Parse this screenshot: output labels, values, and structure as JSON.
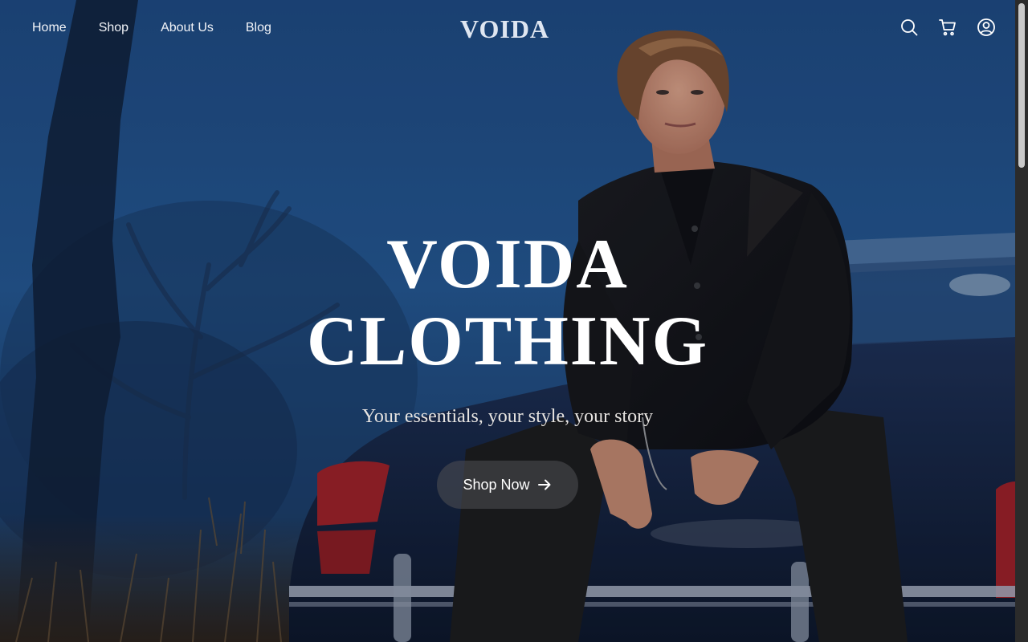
{
  "header": {
    "nav": [
      {
        "label": "Home"
      },
      {
        "label": "Shop"
      },
      {
        "label": "About Us"
      },
      {
        "label": "Blog"
      }
    ],
    "brand": "VOIDA",
    "icons": [
      "search-icon",
      "cart-icon",
      "account-icon"
    ]
  },
  "hero": {
    "title_line1": "VOIDA",
    "title_line2": "CLOTHING",
    "subtitle": "Your essentials, your style, your story",
    "cta_label": "Shop Now",
    "cta_icon": "arrow-right-icon"
  },
  "colors": {
    "sky": "#1f4e86",
    "text": "#ffffff",
    "cta_bg": "#505054"
  }
}
